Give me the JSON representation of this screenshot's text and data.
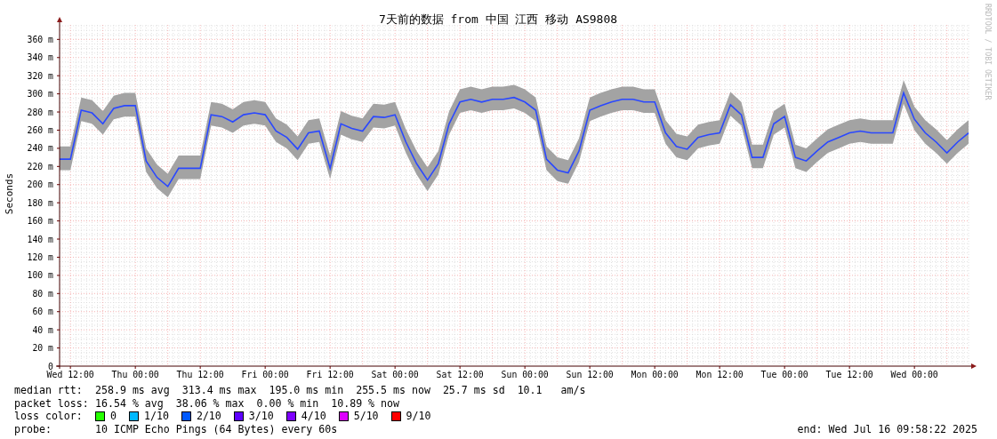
{
  "chart": {
    "chart_data": {
      "type": "line",
      "title": "7天前的数据 from 中国 江西 移动 AS9808",
      "ylabel": "Seconds",
      "ylim": [
        0,
        376
      ],
      "grid": true,
      "yticks": [
        {
          "value": 0,
          "label": "0"
        },
        {
          "value": 20,
          "label": "20 m"
        },
        {
          "value": 40,
          "label": "40 m"
        },
        {
          "value": 60,
          "label": "60 m"
        },
        {
          "value": 80,
          "label": "80 m"
        },
        {
          "value": 100,
          "label": "100 m"
        },
        {
          "value": 120,
          "label": "120 m"
        },
        {
          "value": 140,
          "label": "140 m"
        },
        {
          "value": 160,
          "label": "160 m"
        },
        {
          "value": 180,
          "label": "180 m"
        },
        {
          "value": 200,
          "label": "200 m"
        },
        {
          "value": 220,
          "label": "220 m"
        },
        {
          "value": 240,
          "label": "240 m"
        },
        {
          "value": 260,
          "label": "260 m"
        },
        {
          "value": 280,
          "label": "280 m"
        },
        {
          "value": 300,
          "label": "300 m"
        },
        {
          "value": 320,
          "label": "320 m"
        },
        {
          "value": 340,
          "label": "340 m"
        },
        {
          "value": 360,
          "label": "360 m"
        }
      ],
      "categories": [
        null,
        "Wed 12:00",
        null,
        null,
        null,
        null,
        null,
        "Thu 00:00",
        null,
        null,
        null,
        null,
        null,
        "Thu 12:00",
        null,
        null,
        null,
        null,
        null,
        "Fri 00:00",
        null,
        null,
        null,
        null,
        null,
        "Fri 12:00",
        null,
        null,
        null,
        null,
        null,
        "Sat 00:00",
        null,
        null,
        null,
        null,
        null,
        "Sat 12:00",
        null,
        null,
        null,
        null,
        null,
        "Sun 00:00",
        null,
        null,
        null,
        null,
        null,
        "Sun 12:00",
        null,
        null,
        null,
        null,
        null,
        "Mon 00:00",
        null,
        null,
        null,
        null,
        null,
        "Mon 12:00",
        null,
        null,
        null,
        null,
        null,
        "Tue 00:00",
        null,
        null,
        null,
        null,
        null,
        "Tue 12:00",
        null,
        null,
        null,
        null,
        null,
        "Wed 00:00",
        null,
        null,
        null,
        null,
        null
      ],
      "series": [
        {
          "color": "#2a48ff",
          "values": [
            228,
            228,
            282,
            279,
            267,
            284,
            287,
            287,
            226,
            208,
            198,
            218,
            218,
            218,
            277,
            275,
            269,
            277,
            279,
            277,
            259,
            252,
            239,
            257,
            259,
            218,
            267,
            262,
            259,
            275,
            274,
            277,
            247,
            223,
            205,
            223,
            267,
            291,
            294,
            291,
            294,
            294,
            296,
            291,
            282,
            228,
            216,
            213,
            237,
            282,
            287,
            291,
            294,
            294,
            291,
            291,
            257,
            242,
            239,
            252,
            255,
            257,
            288,
            277,
            230,
            230,
            267,
            275,
            230,
            226,
            237,
            247,
            252,
            257,
            259,
            257,
            257,
            257,
            301,
            272,
            257,
            247,
            235,
            247,
            257
          ]
        }
      ]
    },
    "credit": "RRDTOOL / TOBI OETIKER"
  },
  "stats": [
    {
      "label": "median rtt:",
      "text": "258.9 ms avg  313.4 ms max  195.0 ms min  255.5 ms now  25.7 ms sd  10.1   am/s"
    },
    {
      "label": "packet loss:",
      "text": "16.54 % avg  38.06 % max  0.00 % min  10.89 % now"
    }
  ],
  "loss_legend": {
    "label": "loss color:",
    "items": [
      {
        "label": "0",
        "color": "#26ff00"
      },
      {
        "label": "1/10",
        "color": "#00b8ff"
      },
      {
        "label": "2/10",
        "color": "#0059ff"
      },
      {
        "label": "3/10",
        "color": "#5e00ff"
      },
      {
        "label": "4/10",
        "color": "#7e00ff"
      },
      {
        "label": "5/10",
        "color": "#dd00ff"
      },
      {
        "label": "9/10",
        "color": "#ff0000"
      }
    ]
  },
  "probe": {
    "label": "probe:",
    "text": "10 ICMP Echo Pings (64 Bytes) every 60s",
    "end": "end: Wed Jul 16 09:58:22 2025"
  }
}
